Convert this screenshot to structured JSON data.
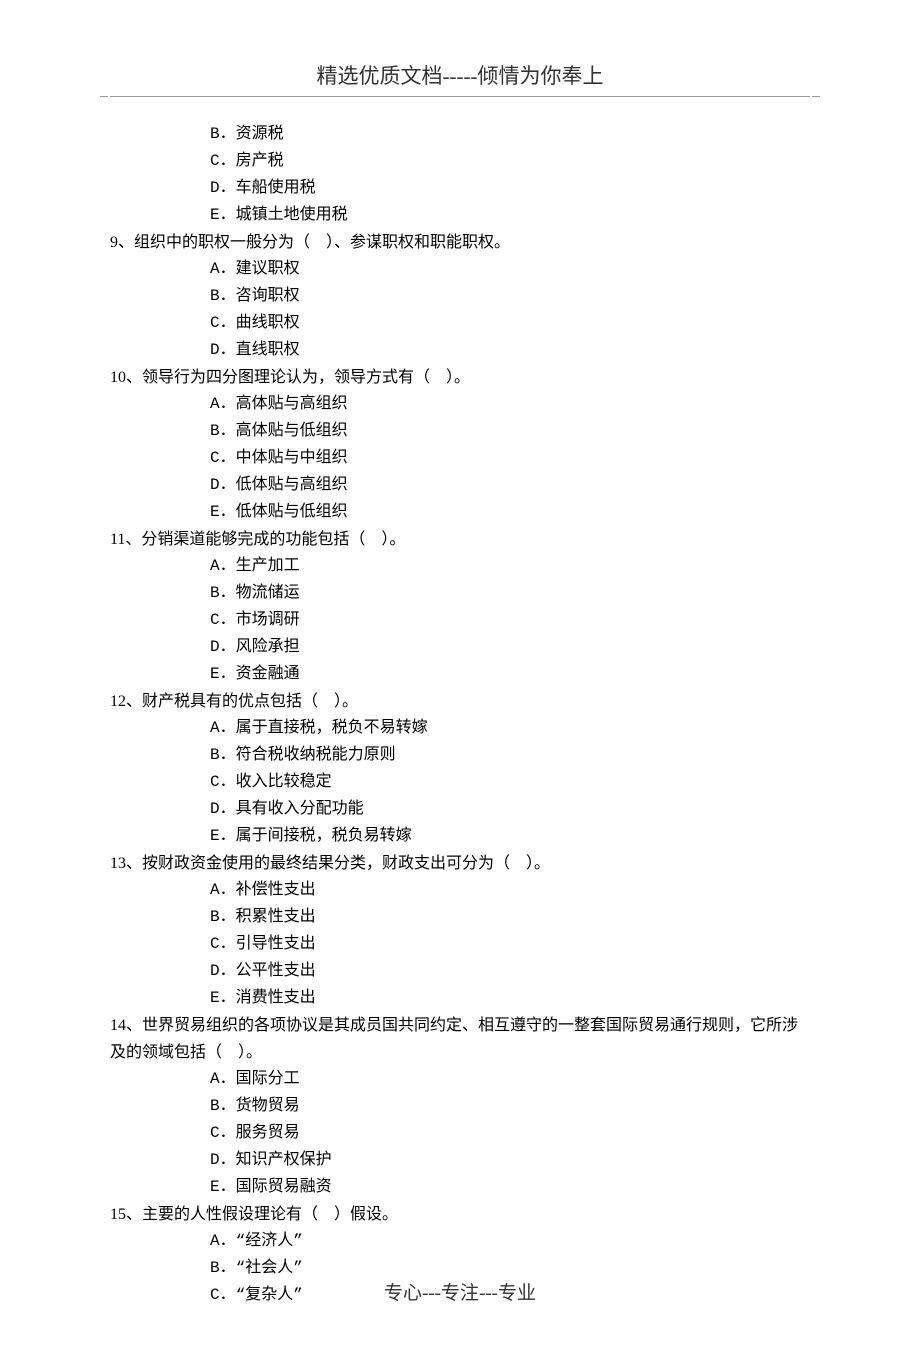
{
  "header": "精选优质文档-----倾情为你奉上",
  "footer": "专心---专注---专业",
  "pre_options": [
    "B．资源税",
    "C．房产税",
    "D．车船使用税",
    "E．城镇土地使用税"
  ],
  "questions": [
    {
      "stem": "9、组织中的职权一般分为（　）、参谋职权和职能职权。",
      "options": [
        "A．建议职权",
        "B．咨询职权",
        "C．曲线职权",
        "D．直线职权"
      ]
    },
    {
      "stem": "10、领导行为四分图理论认为，领导方式有（　）。",
      "options": [
        "A．高体贴与高组织",
        "B．高体贴与低组织",
        "C．中体贴与中组织",
        "D．低体贴与高组织",
        "E．低体贴与低组织"
      ]
    },
    {
      "stem": "11、分销渠道能够完成的功能包括（　）。",
      "options": [
        "A．生产加工",
        "B．物流储运",
        "C．市场调研",
        "D．风险承担",
        "E．资金融通"
      ]
    },
    {
      "stem": "12、财产税具有的优点包括（　）。",
      "options": [
        "A．属于直接税，税负不易转嫁",
        "B．符合税收纳税能力原则",
        "C．收入比较稳定",
        "D．具有收入分配功能",
        "E．属于间接税，税负易转嫁"
      ]
    },
    {
      "stem": "13、按财政资金使用的最终结果分类，财政支出可分为（　）。",
      "options": [
        "A．补偿性支出",
        "B．积累性支出",
        "C．引导性支出",
        "D．公平性支出",
        "E．消费性支出"
      ]
    },
    {
      "stem": "14、世界贸易组织的各项协议是其成员国共同约定、相互遵守的一整套国际贸易通行规则，它所涉及的领域包括（　）。",
      "options": [
        "A．国际分工",
        "B．货物贸易",
        "C．服务贸易",
        "D．知识产权保护",
        "E．国际贸易融资"
      ]
    },
    {
      "stem": "15、主要的人性假设理论有（　）假设。",
      "options": [
        "A．“经济人”",
        "B．“社会人”",
        "C．“复杂人”"
      ]
    }
  ]
}
